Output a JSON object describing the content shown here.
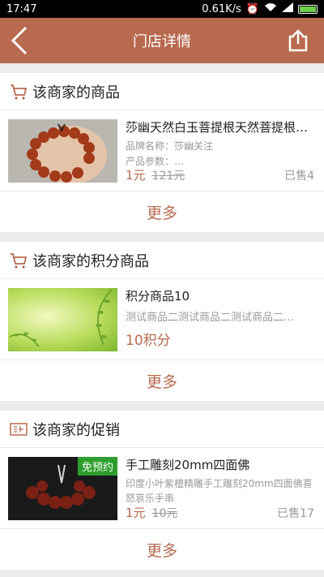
{
  "status_bar": {
    "time": "17:47",
    "speed": "0.61K/s"
  },
  "nav": {
    "title": "门店详情"
  },
  "sections": [
    {
      "title": "该商家的商品",
      "more": "更多"
    },
    {
      "title": "该商家的积分商品",
      "more": "更多"
    },
    {
      "title": "该商家的促销",
      "more": "更多"
    }
  ],
  "product": {
    "name": "莎幽天然白玉菩提根天然菩提根…",
    "brand": "品牌名称：莎幽关注",
    "params": "产品参数：…",
    "price": "1元",
    "old_price": "121元",
    "sold": "已售4"
  },
  "points_product": {
    "name": "积分商品10",
    "desc": "测试商品二测试商品二测试商品二…",
    "points": "10积分"
  },
  "promo": {
    "badge": "免预约",
    "name": "手工雕刻20mm四面佛",
    "desc": "印度小叶紫檀精雕手工雕刻20mm四面佛喜怒哀乐手串",
    "price": "1元",
    "old_price": "10元",
    "sold": "已售17"
  },
  "colors": {
    "accent": "#b86a4f",
    "nav_bg": "#b86a4f",
    "badge": "#2e9f2e"
  },
  "icons": [
    "back-arrow-icon",
    "share-icon",
    "cart-icon",
    "coupon-icon"
  ]
}
